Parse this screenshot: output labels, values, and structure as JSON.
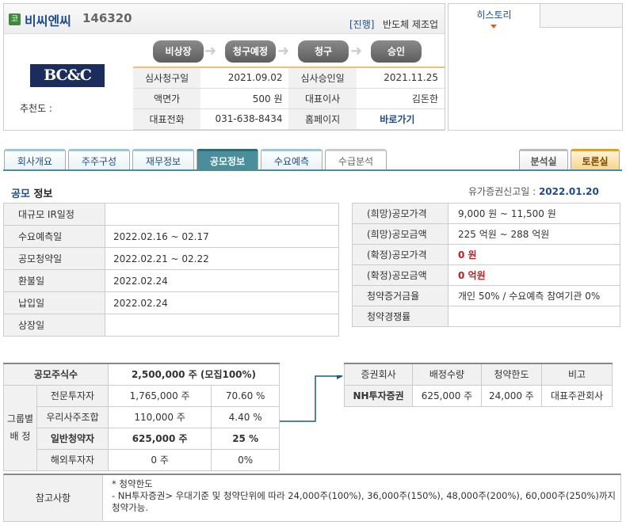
{
  "company": {
    "market_icon": "코",
    "name": "비씨엔씨",
    "code": "146320",
    "status": "[진행]",
    "industry": "반도체 제조업",
    "logo_text": "BC&C",
    "recommend_label": "추천도 :"
  },
  "steps": [
    "비상장",
    "청구예정",
    "청구",
    "승인"
  ],
  "info": [
    {
      "l1": "심사청구일",
      "v1": "2021.09.02",
      "l2": "심사승인일",
      "v2": "2021.11.25"
    },
    {
      "l1": "액면가",
      "v1": "500 원",
      "l2": "대표이사",
      "v2": "김돈한"
    },
    {
      "l1": "대표전화",
      "v1": "031-638-8434",
      "l2": "홈페이지",
      "v2": "바로가기"
    }
  ],
  "history_tab": "히스토리",
  "tabs": [
    "회사개요",
    "주주구성",
    "재무정보",
    "공모정보",
    "수요예측",
    "수급분석"
  ],
  "right_tabs": [
    "분석실",
    "토론실"
  ],
  "section": {
    "title_a": "공모",
    "title_b": " 정보",
    "filing_label": "유가증권신고일 : ",
    "filing_date": "2022.01.20"
  },
  "schedule": [
    {
      "label": "대규모 IR일정",
      "value": ""
    },
    {
      "label": "수요예측일",
      "value": "2022.02.16 ~ 02.17"
    },
    {
      "label": "공모청약일",
      "value": "2022.02.21 ~ 02.22"
    },
    {
      "label": "환불일",
      "value": "2022.02.24"
    },
    {
      "label": "납입일",
      "value": "2022.02.24"
    },
    {
      "label": "상장일",
      "value": ""
    }
  ],
  "offering": [
    {
      "label": "(희망)공모가격",
      "value": "9,000 원 ~ 11,500 원"
    },
    {
      "label": "(희망)공모금액",
      "value": "225 억원  ~ 288 억원"
    },
    {
      "label": "(확정)공모가격",
      "value": "0 원"
    },
    {
      "label": "(확정)공모금액",
      "value": "0 억원"
    },
    {
      "label": "청약증거금율",
      "value": "개인 50% / 수요예측 참여기관 0%"
    },
    {
      "label": "청약경쟁률",
      "value": ""
    }
  ],
  "allocation": {
    "total_label": "공모주식수",
    "total_value": "2,500,000 주 (모집100%)",
    "group_label_1": "그룹별",
    "group_label_2": "배 정",
    "rows": [
      {
        "name": "전문투자자",
        "shares": "1,765,000 주",
        "pct": "70.60 %"
      },
      {
        "name": "우리사주조합",
        "shares": "110,000 주",
        "pct": "4.40 %"
      },
      {
        "name": "일반청약자",
        "shares": "625,000 주",
        "pct": "25 %"
      },
      {
        "name": "해외투자자",
        "shares": "0 주",
        "pct": "0%"
      }
    ]
  },
  "underwriters": {
    "headers": [
      "증권회사",
      "배정수량",
      "청약한도",
      "비고"
    ],
    "rows": [
      {
        "firm": "NH투자증권",
        "qty": "625,000 주",
        "limit": "24,000 주",
        "note": "대표주관회사"
      }
    ]
  },
  "note": {
    "label": "참고사항",
    "line1": "* 청약한도",
    "line2": "- NH투자증권> 우대기준 및 청약단위에 따라 24,000주(100%), 36,000주(150%), 48,000주(200%), 60,000주(250%)까지",
    "line3": "청약가능."
  }
}
